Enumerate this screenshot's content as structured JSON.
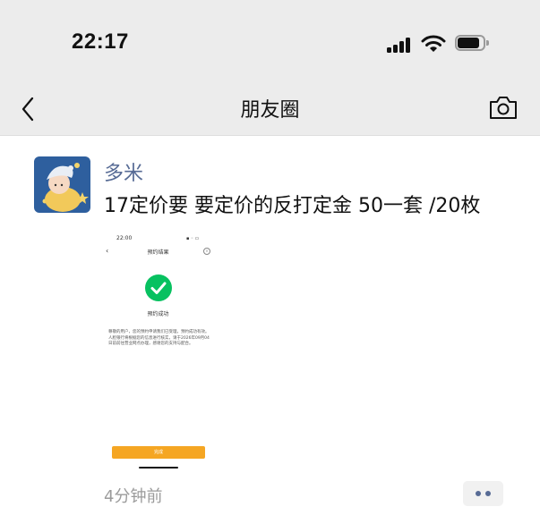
{
  "status_bar": {
    "time": "22:17"
  },
  "nav": {
    "title": "朋友圈"
  },
  "post": {
    "author": "多米",
    "text": "17定价要 要定价的反打定金 50一套 /20枚",
    "timestamp": "4分钟前",
    "attachment": {
      "status_time": "22:00",
      "title": "预约结果",
      "result_text": "预约成功",
      "description": "尊敬的用户，您的预约申请我们已受理，预约成功有效。人脸银行将根据您的信息进行核实，请于2026年09月04日前前往营业网点办理，感谢您的支持与配合。",
      "button_label": "完成",
      "accent_color": "#07c160",
      "button_color": "#f5a623"
    }
  },
  "colors": {
    "nav_bg": "#ececec",
    "link": "#576b95",
    "muted": "#9b9b9b"
  }
}
